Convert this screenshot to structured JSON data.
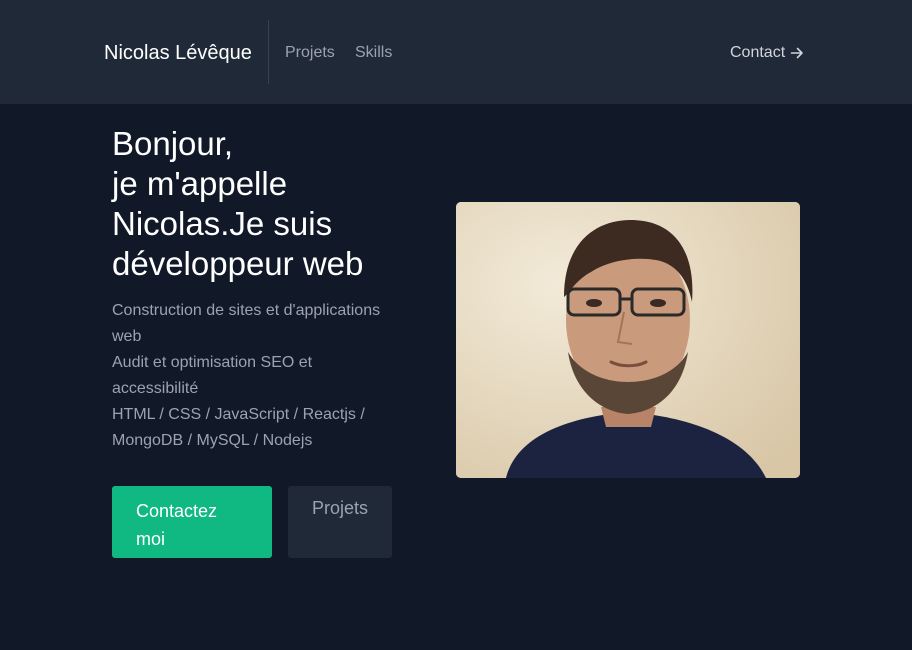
{
  "header": {
    "brand": "Nicolas Lévêque",
    "nav": {
      "projets": "Projets",
      "skills": "Skills"
    },
    "contact": "Contact"
  },
  "hero": {
    "title_lines": [
      "Bonjour,",
      "je m'appelle",
      "Nicolas.Je suis",
      "développeur web"
    ],
    "description_lines": [
      "Construction de sites et d'applications web",
      "Audit et optimisation SEO et accessibilité",
      "HTML / CSS / JavaScript / Reactjs / MongoDB / MySQL / Nodejs"
    ],
    "buttons": {
      "contact": "Contactez moi",
      "projets": "Projets"
    }
  },
  "colors": {
    "background": "#111827",
    "header": "#1f2937",
    "accent": "#10b981",
    "muted_text": "#9ca3af"
  },
  "icons": {
    "contact_arrow": "arrow-right-icon"
  }
}
